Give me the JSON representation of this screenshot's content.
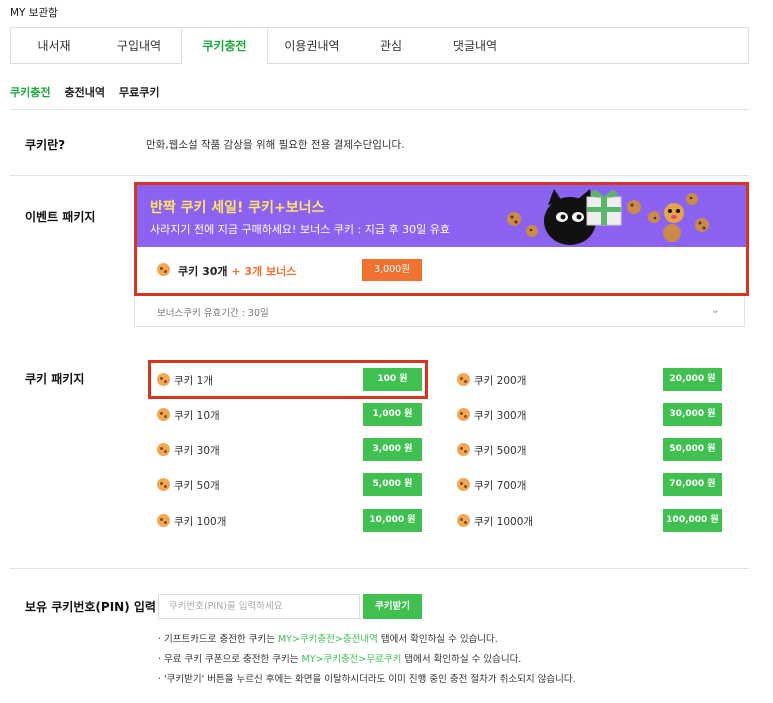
{
  "header": {
    "title": "MY 보관함"
  },
  "tabs": [
    {
      "label": "내서재"
    },
    {
      "label": "구입내역"
    },
    {
      "label": "쿠키충전"
    },
    {
      "label": "이용권내역"
    },
    {
      "label": "관심"
    },
    {
      "label": "댓글내역"
    }
  ],
  "subtabs": [
    {
      "label": "쿠키충전"
    },
    {
      "label": "충전내역"
    },
    {
      "label": "무료쿠키"
    }
  ],
  "cookie_info": {
    "label": "쿠키란?",
    "description": "만화,웹소설 작품 감상을 위해 필요한 전용 결제수단입니다."
  },
  "event": {
    "label": "이벤트 패키지",
    "banner_title": "반짝 쿠키 세일! 쿠키+보너스",
    "banner_subtitle": "사라지기 전에 지금 구매하세요! 보너스 쿠키 : 지급 후 30일 유효",
    "item_name": "쿠키 30개",
    "item_bonus": "+ 3개 보너스",
    "item_price": "3,000원",
    "validity": "보너스쿠키 유효기간 : 30일"
  },
  "packages": {
    "label": "쿠키 패키지",
    "left": [
      {
        "name": "쿠키 1개",
        "price": "100 원"
      },
      {
        "name": "쿠키 10개",
        "price": "1,000 원"
      },
      {
        "name": "쿠키 30개",
        "price": "3,000 원"
      },
      {
        "name": "쿠키 50개",
        "price": "5,000 원"
      },
      {
        "name": "쿠키 100개",
        "price": "10,000 원"
      }
    ],
    "right": [
      {
        "name": "쿠키 200개",
        "price": "20,000 원"
      },
      {
        "name": "쿠키 300개",
        "price": "30,000 원"
      },
      {
        "name": "쿠키 500개",
        "price": "50,000 원"
      },
      {
        "name": "쿠키 700개",
        "price": "70,000 원"
      },
      {
        "name": "쿠키 1000개",
        "price": "100,000 원"
      }
    ]
  },
  "pin": {
    "label": "보유 쿠키번호(PIN) 입력",
    "placeholder": "쿠키번호(PIN)를 입력하세요",
    "button": "쿠키받기"
  },
  "notes": {
    "n1_a": "· 기프트카드로 충전한 쿠키는 ",
    "n1_link": "MY>쿠키충전>충전내역",
    "n1_b": " 탭에서 확인하실 수 있습니다.",
    "n2_a": "· 무료 쿠키 쿠폰으로 충전한 쿠키는 ",
    "n2_link": "MY>쿠키충전>무료쿠키",
    "n2_b": " 탭에서 확인하실 수 있습니다.",
    "n3": "· '쿠키받기' 버튼을 누르신 후에는 화면을 이탈하시더라도 이미 진행 중인 충전 절차가 취소되지 않습니다."
  },
  "colors": {
    "accent": "#19a83a",
    "button_green": "#3fc051",
    "button_orange": "#f07230",
    "banner": "#8b63f0",
    "highlight": "#d6361f"
  }
}
